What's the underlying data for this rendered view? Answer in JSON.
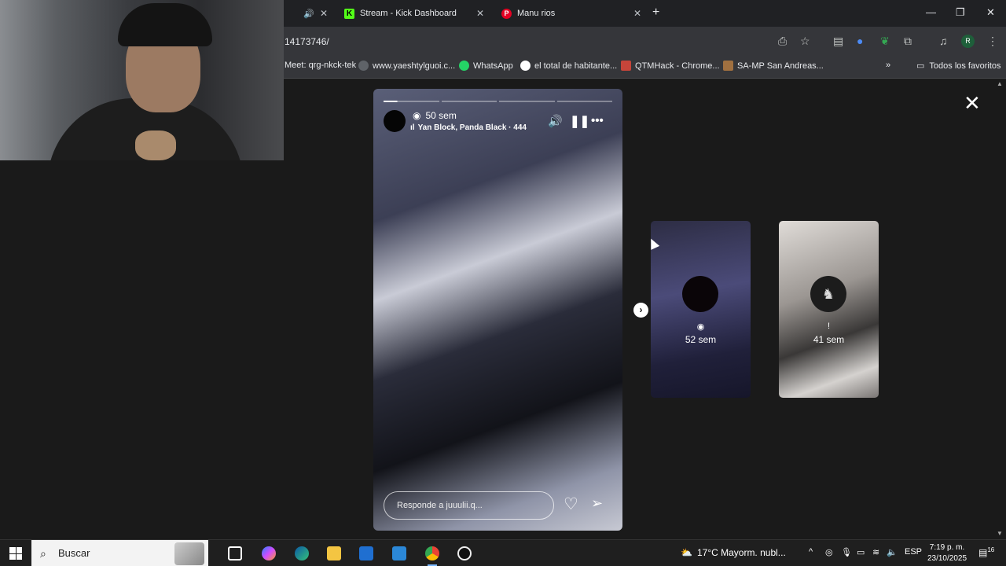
{
  "tabs": [
    {
      "label": "Stream - Kick Dashboard",
      "favicon": "kick-icon"
    },
    {
      "label": "Manu rios",
      "favicon": "pinterest-icon"
    }
  ],
  "address": {
    "url": "14173746/"
  },
  "bookmarks": [
    {
      "label": "Meet: qrg-nkck-tek"
    },
    {
      "label": "www.yaeshtylguoi.c..."
    },
    {
      "label": "WhatsApp"
    },
    {
      "label": "el total de habitante..."
    },
    {
      "label": "QTMHack - Chrome..."
    },
    {
      "label": "SA-MP San Andreas..."
    }
  ],
  "bookmarks_folder": "Todos los favoritos",
  "profile_initial": "R",
  "story": {
    "views": "50 sem",
    "music": "Yan Block, Panda Black · 444",
    "reply_placeholder": "Responde a juuulii.q..."
  },
  "previews": [
    {
      "time": "52 sem",
      "icon": "eye-icon"
    },
    {
      "time": "41 sem",
      "icon": "exclamation-icon",
      "icon_text": "!"
    }
  ],
  "taskbar": {
    "search": "Buscar",
    "weather": "17°C  Mayorm. nubl...",
    "language": "ESP",
    "time": "7:19 p. m.",
    "date": "23/10/2025",
    "notifications": "16"
  },
  "colors": {
    "kick": "#53fc18",
    "pinterest": "#e60023",
    "chrome_dark": "#202124",
    "toolbar": "#35363a"
  }
}
